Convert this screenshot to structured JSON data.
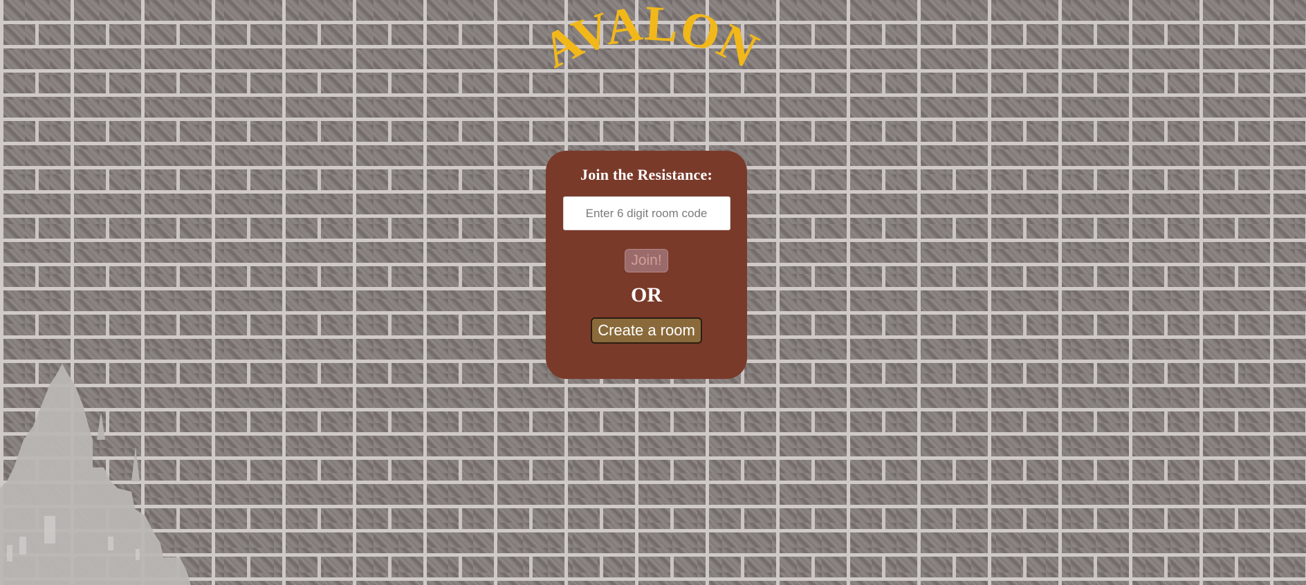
{
  "app": {
    "logo_text": "AVALON",
    "logo_color": "#f2b81a"
  },
  "join_panel": {
    "title": "Join the Resistance:",
    "room_code_placeholder": "Enter 6 digit room code",
    "room_code_value": "",
    "join_label": "Join!",
    "or_label": "OR",
    "create_label": "Create a room",
    "background_color": "#7a3a2a"
  },
  "icons": {
    "castle": "castle-silhouette"
  }
}
